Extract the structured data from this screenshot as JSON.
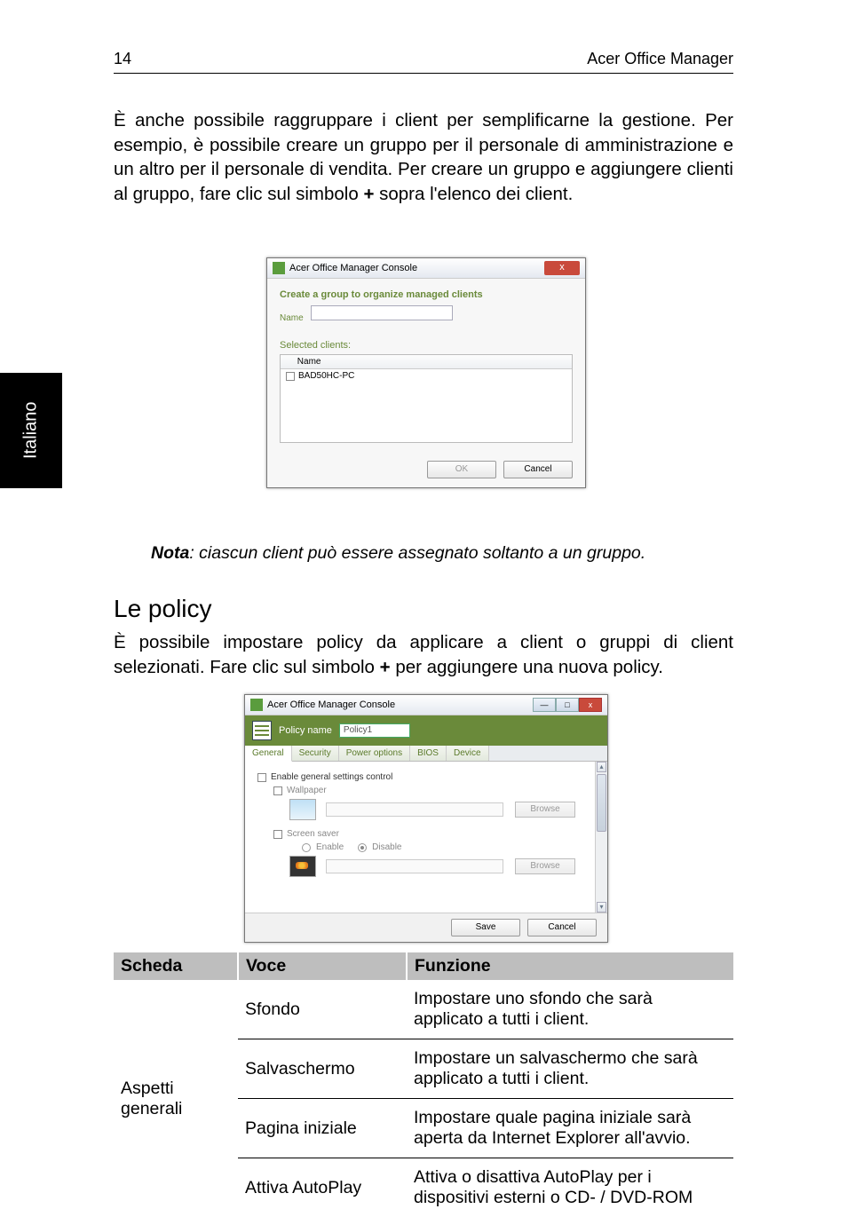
{
  "page_number": "14",
  "header_right": "Acer Office Manager",
  "paragraph1": "È anche possibile raggruppare i client per semplificarne la gestione. Per esempio, è possibile creare un gruppo per il personale di amministrazione e un altro per il personale di vendita. Per creare un gruppo e aggiungere clienti al gruppo, fare clic sul simbolo ",
  "paragraph1_bold": "+",
  "paragraph1_tail": " sopra l'elenco dei client.",
  "side_tab": "Italiano",
  "dialog1": {
    "title": "Acer Office Manager Console",
    "close": "x",
    "heading": "Create a group to organize managed clients",
    "name_label": "Name",
    "selected_label": "Selected clients:",
    "col_name": "Name",
    "row1": "BAD50HC-PC",
    "ok": "OK",
    "cancel": "Cancel"
  },
  "note_bold": "Nota",
  "note_rest": ": ciascun client può essere assegnato soltanto a un gruppo.",
  "h2": "Le policy",
  "paragraph2": "È possibile impostare policy da applicare a client o gruppi di client selezionati. Fare clic sul simbolo ",
  "paragraph2_bold": "+",
  "paragraph2_tail": " per aggiungere una nuova policy.",
  "dialog2": {
    "title": "Acer Office Manager Console",
    "min": "—",
    "max": "□",
    "close": "x",
    "policy_name_label": "Policy name",
    "policy_name_value": "Policy1",
    "tabs": [
      "General",
      "Security",
      "Power options",
      "BIOS",
      "Device"
    ],
    "enable_label": "Enable general settings control",
    "wallpaper": "Wallpaper",
    "browse": "Browse",
    "screensaver": "Screen saver",
    "enable": "Enable",
    "disable": "Disable",
    "save": "Save",
    "cancel": "Cancel"
  },
  "table": {
    "headers": [
      "Scheda",
      "Voce",
      "Funzione"
    ],
    "col1": "Aspetti generali",
    "rows": [
      {
        "voce": "Sfondo",
        "fun": "Impostare uno sfondo che sarà applicato a tutti i client."
      },
      {
        "voce": "Salvaschermo",
        "fun": "Impostare un salvaschermo che sarà applicato a tutti i client."
      },
      {
        "voce": "Pagina iniziale",
        "fun": "Impostare quale pagina iniziale sarà aperta da Internet Explorer all'avvio."
      },
      {
        "voce": "Attiva AutoPlay",
        "fun": "Attiva o disattiva AutoPlay per i dispositivi esterni o CD- / DVD-ROM"
      }
    ]
  }
}
